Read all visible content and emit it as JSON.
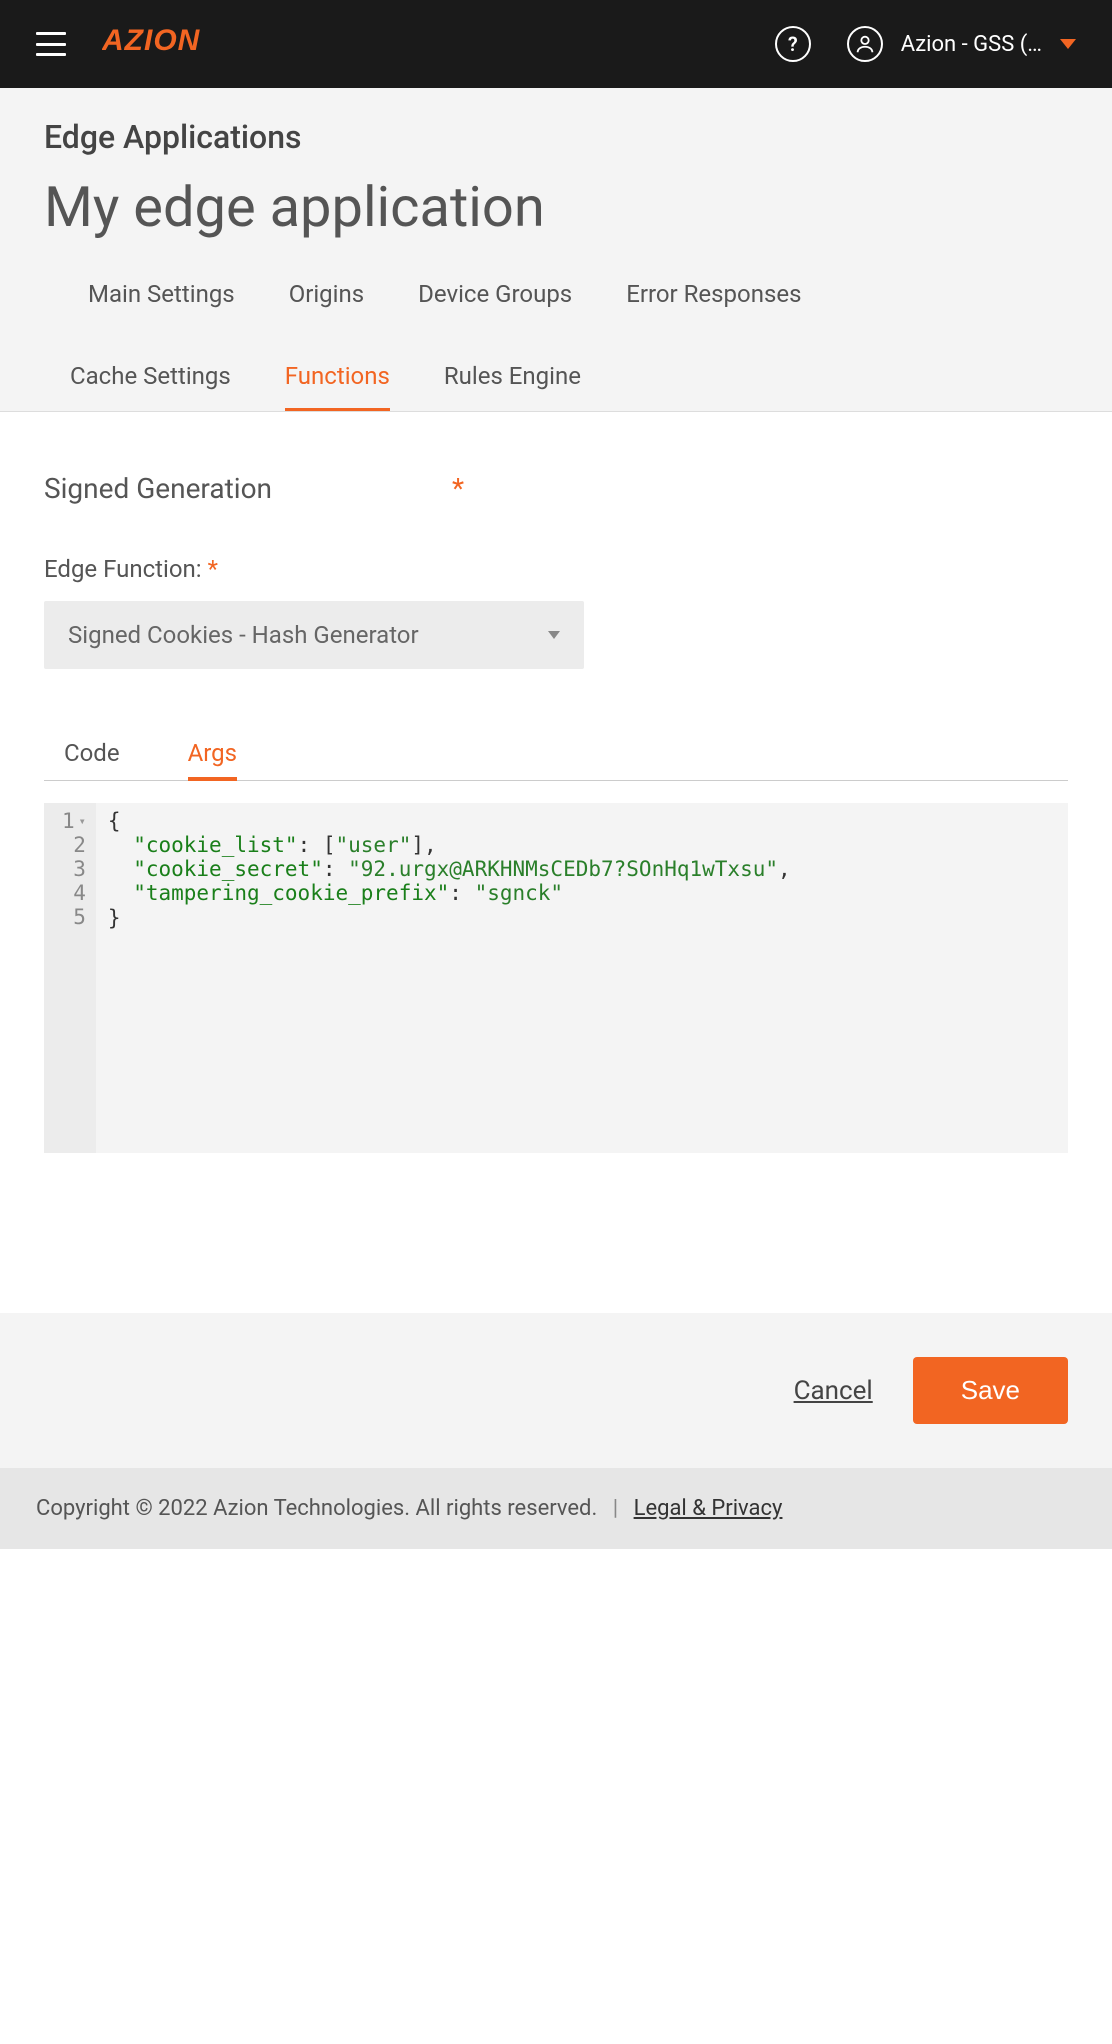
{
  "header": {
    "account_label": "Azion - GSS (…"
  },
  "page": {
    "breadcrumb": "Edge Applications",
    "title": "My edge application"
  },
  "tabs": {
    "main_settings": "Main Settings",
    "origins": "Origins",
    "device_groups": "Device Groups",
    "error_responses": "Error Responses",
    "cache_settings": "Cache Settings",
    "functions": "Functions",
    "rules_engine": "Rules Engine"
  },
  "form": {
    "name_value": "Signed Generation",
    "edge_function_label": "Edge Function:",
    "edge_function_selected": "Signed Cookies - Hash Generator"
  },
  "subtabs": {
    "code": "Code",
    "args": "Args"
  },
  "editor": {
    "lines": [
      "1",
      "2",
      "3",
      "4",
      "5"
    ],
    "args_json": {
      "cookie_list": [
        "user"
      ],
      "cookie_secret": "92.urgx@ARKHNMsCEDb7?SOnHq1wTxsu",
      "tampering_cookie_prefix": "sgnck"
    }
  },
  "actions": {
    "cancel": "Cancel",
    "save": "Save"
  },
  "footer": {
    "copyright": "Copyright © 2022 Azion Technologies. All rights reserved.",
    "legal": "Legal & Privacy"
  }
}
